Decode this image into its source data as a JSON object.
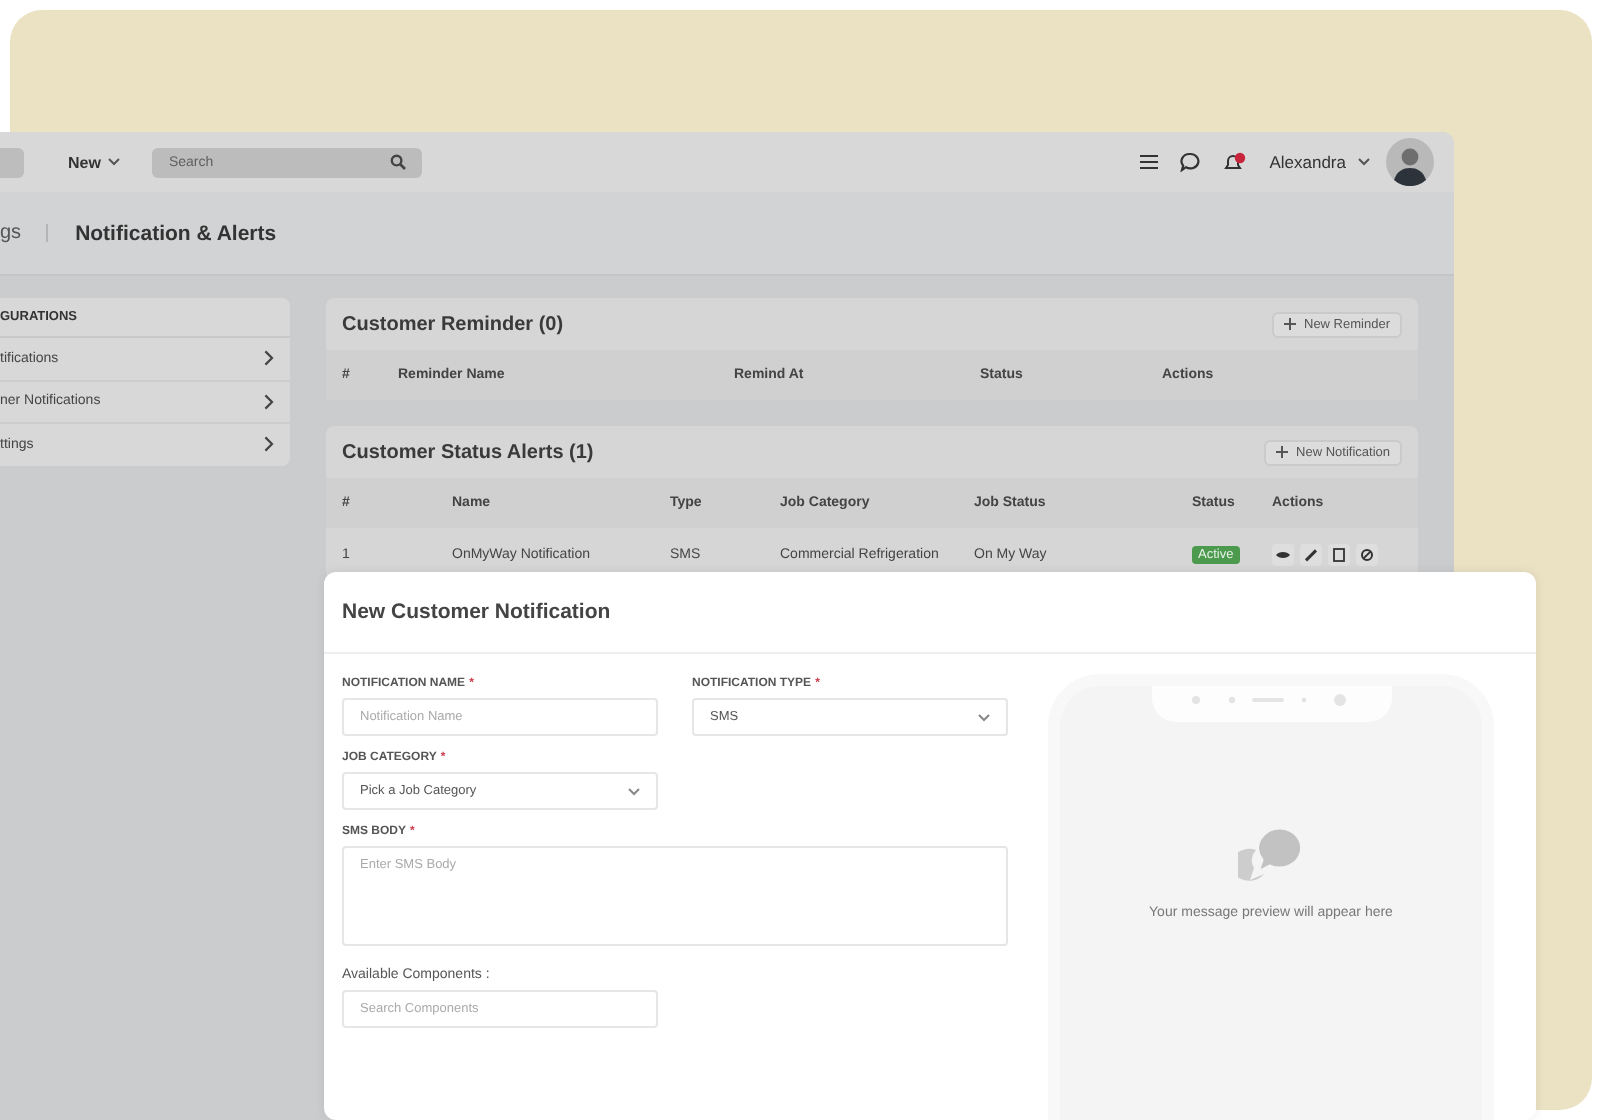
{
  "topbar": {
    "new_menu": "New",
    "search": {
      "placeholder": "Search"
    },
    "user": "Alexandra"
  },
  "breadcrumb": {
    "parent": "gs",
    "current": "Notification & Alerts"
  },
  "sidebar": {
    "heading": "GURATIONS",
    "items": [
      {
        "label": "tifications"
      },
      {
        "label": "ner Notifications"
      },
      {
        "label": "ttings"
      }
    ]
  },
  "reminders": {
    "title": "Customer Reminder (0)",
    "button": "New Reminder",
    "columns": [
      "#",
      "Reminder Name",
      "Remind At",
      "Status",
      "Actions"
    ]
  },
  "alerts": {
    "title": "Customer Status Alerts (1)",
    "button": "New Notification",
    "columns": [
      "#",
      "Name",
      "Type",
      "Job Category",
      "Job Status",
      "Status",
      "Actions"
    ],
    "rows": [
      {
        "cells": [
          "1",
          "OnMyWay Notification",
          "SMS",
          "Commercial Refrigeration",
          "On My Way"
        ],
        "status": "Active"
      }
    ]
  },
  "modal": {
    "title": "New Customer Notification",
    "fields": [
      {
        "kind": "input",
        "label": "NOTIFICATION NAME",
        "required": true,
        "placeholder": "Notification Name"
      },
      {
        "kind": "select",
        "label": "NOTIFICATION TYPE",
        "required": true,
        "value": "SMS"
      },
      {
        "kind": "select",
        "label": "JOB CATEGORY",
        "required": true,
        "value": "Pick a Job Category"
      },
      {
        "kind": "textarea",
        "label": "SMS BODY",
        "required": true,
        "placeholder": "Enter SMS Body"
      },
      {
        "kind": "input",
        "label": "Available Components :",
        "required": false,
        "placeholder": "Search Components"
      }
    ],
    "required_mark": "*",
    "preview": "Your message preview will appear here"
  }
}
